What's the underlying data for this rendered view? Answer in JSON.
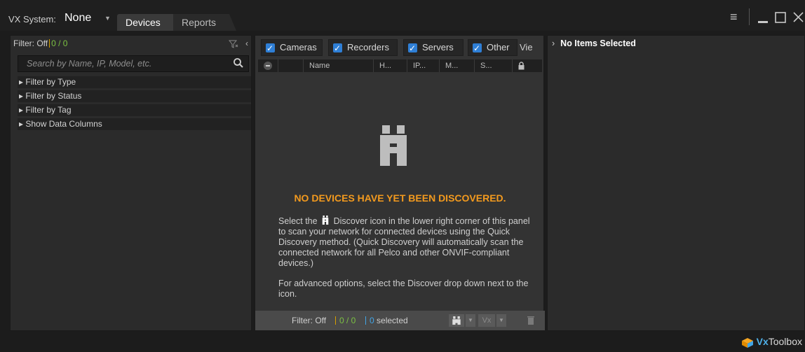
{
  "titlebar": {
    "system_label": "VX System:",
    "system_value": "None",
    "tabs": [
      {
        "label": "Devices",
        "active": true
      },
      {
        "label": "Reports",
        "active": false
      }
    ]
  },
  "left_panel": {
    "filter_label": "Filter: Off",
    "filter_count": "0 / 0",
    "search_placeholder": "Search by Name, IP, Model, etc.",
    "sections": [
      {
        "label": "▸ Filter by Type"
      },
      {
        "label": "▸ Filter by Status"
      },
      {
        "label": "▸ Filter by Tag"
      },
      {
        "label": "▸ Show Data Columns"
      }
    ]
  },
  "middle_panel": {
    "type_filters": [
      {
        "label": "Cameras",
        "checked": true
      },
      {
        "label": "Recorders",
        "checked": true
      },
      {
        "label": "Servers",
        "checked": true
      },
      {
        "label": "Other",
        "checked": true
      }
    ],
    "view_label": "Vie",
    "columns": [
      "Name",
      "H...",
      "IP...",
      "M...",
      "S..."
    ],
    "empty_title": "NO DEVICES HAVE YET BEEN DISCOVERED.",
    "empty_text_before_icon": "Select the",
    "empty_text_after_icon": "Discover icon in the lower right corner of this panel to scan your network for connected devices using the Quick Discovery method. (Quick Discovery will automatically scan the connected network for all Pelco and other ONVIF-compliant devices.)",
    "empty_text_advanced": "For advanced options, select the Discover drop down next to the icon.",
    "bottom": {
      "filter_label": "Filter: Off",
      "count": "0 / 0",
      "selected_count": "0",
      "selected_label": "selected"
    }
  },
  "right_panel": {
    "title": "No Items Selected"
  },
  "footer": {
    "brand_prefix": "Vx",
    "brand_suffix": "Toolbox"
  },
  "colors": {
    "accent_orange": "#f39a1e",
    "count_green": "#7bc142",
    "selected_blue": "#42a5e6",
    "checkbox_blue": "#2f7fd6"
  }
}
